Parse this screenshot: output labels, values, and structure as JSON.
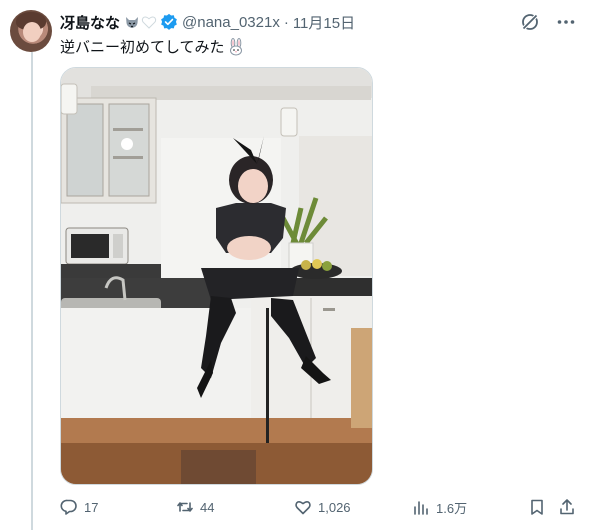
{
  "post": {
    "display_name": "冴島なな",
    "handle": "@nana_0321x",
    "separator": "·",
    "date": "11月15日",
    "text": "逆バニー初めてしてみた",
    "icons": {
      "name_emojis": [
        "wolf-icon",
        "white-heart-icon"
      ],
      "verified": "verified-badge-icon",
      "text_emoji": "rabbit-icon",
      "top_right": [
        "grok-icon",
        "more-icon"
      ]
    },
    "colors": {
      "verified": "#1d9bf0",
      "muted": "#536471",
      "text": "#0f1419"
    }
  },
  "actions": {
    "reply_count": "17",
    "repost_count": "44",
    "like_count": "1,026",
    "view_count": "1.6万"
  }
}
